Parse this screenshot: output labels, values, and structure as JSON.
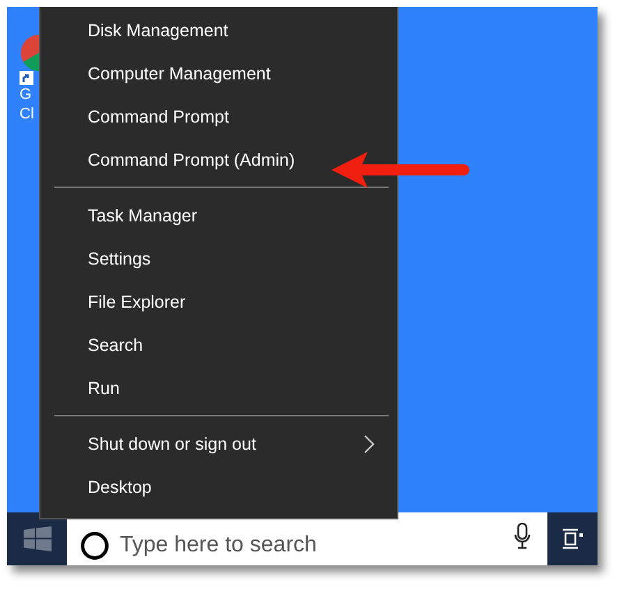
{
  "desktop_icon": {
    "label_lines": [
      "G",
      "Cl"
    ]
  },
  "context_menu": {
    "groups": [
      {
        "items": [
          {
            "label": "Disk Management",
            "submenu": false
          },
          {
            "label": "Computer Management",
            "submenu": false
          },
          {
            "label": "Command Prompt",
            "submenu": false
          },
          {
            "label": "Command Prompt (Admin)",
            "submenu": false
          }
        ]
      },
      {
        "items": [
          {
            "label": "Task Manager",
            "submenu": false
          },
          {
            "label": "Settings",
            "submenu": false
          },
          {
            "label": "File Explorer",
            "submenu": false
          },
          {
            "label": "Search",
            "submenu": false
          },
          {
            "label": "Run",
            "submenu": false
          }
        ]
      },
      {
        "items": [
          {
            "label": "Shut down or sign out",
            "submenu": true
          },
          {
            "label": "Desktop",
            "submenu": false
          }
        ]
      }
    ]
  },
  "taskbar": {
    "search": {
      "placeholder": "Type here to search"
    }
  }
}
